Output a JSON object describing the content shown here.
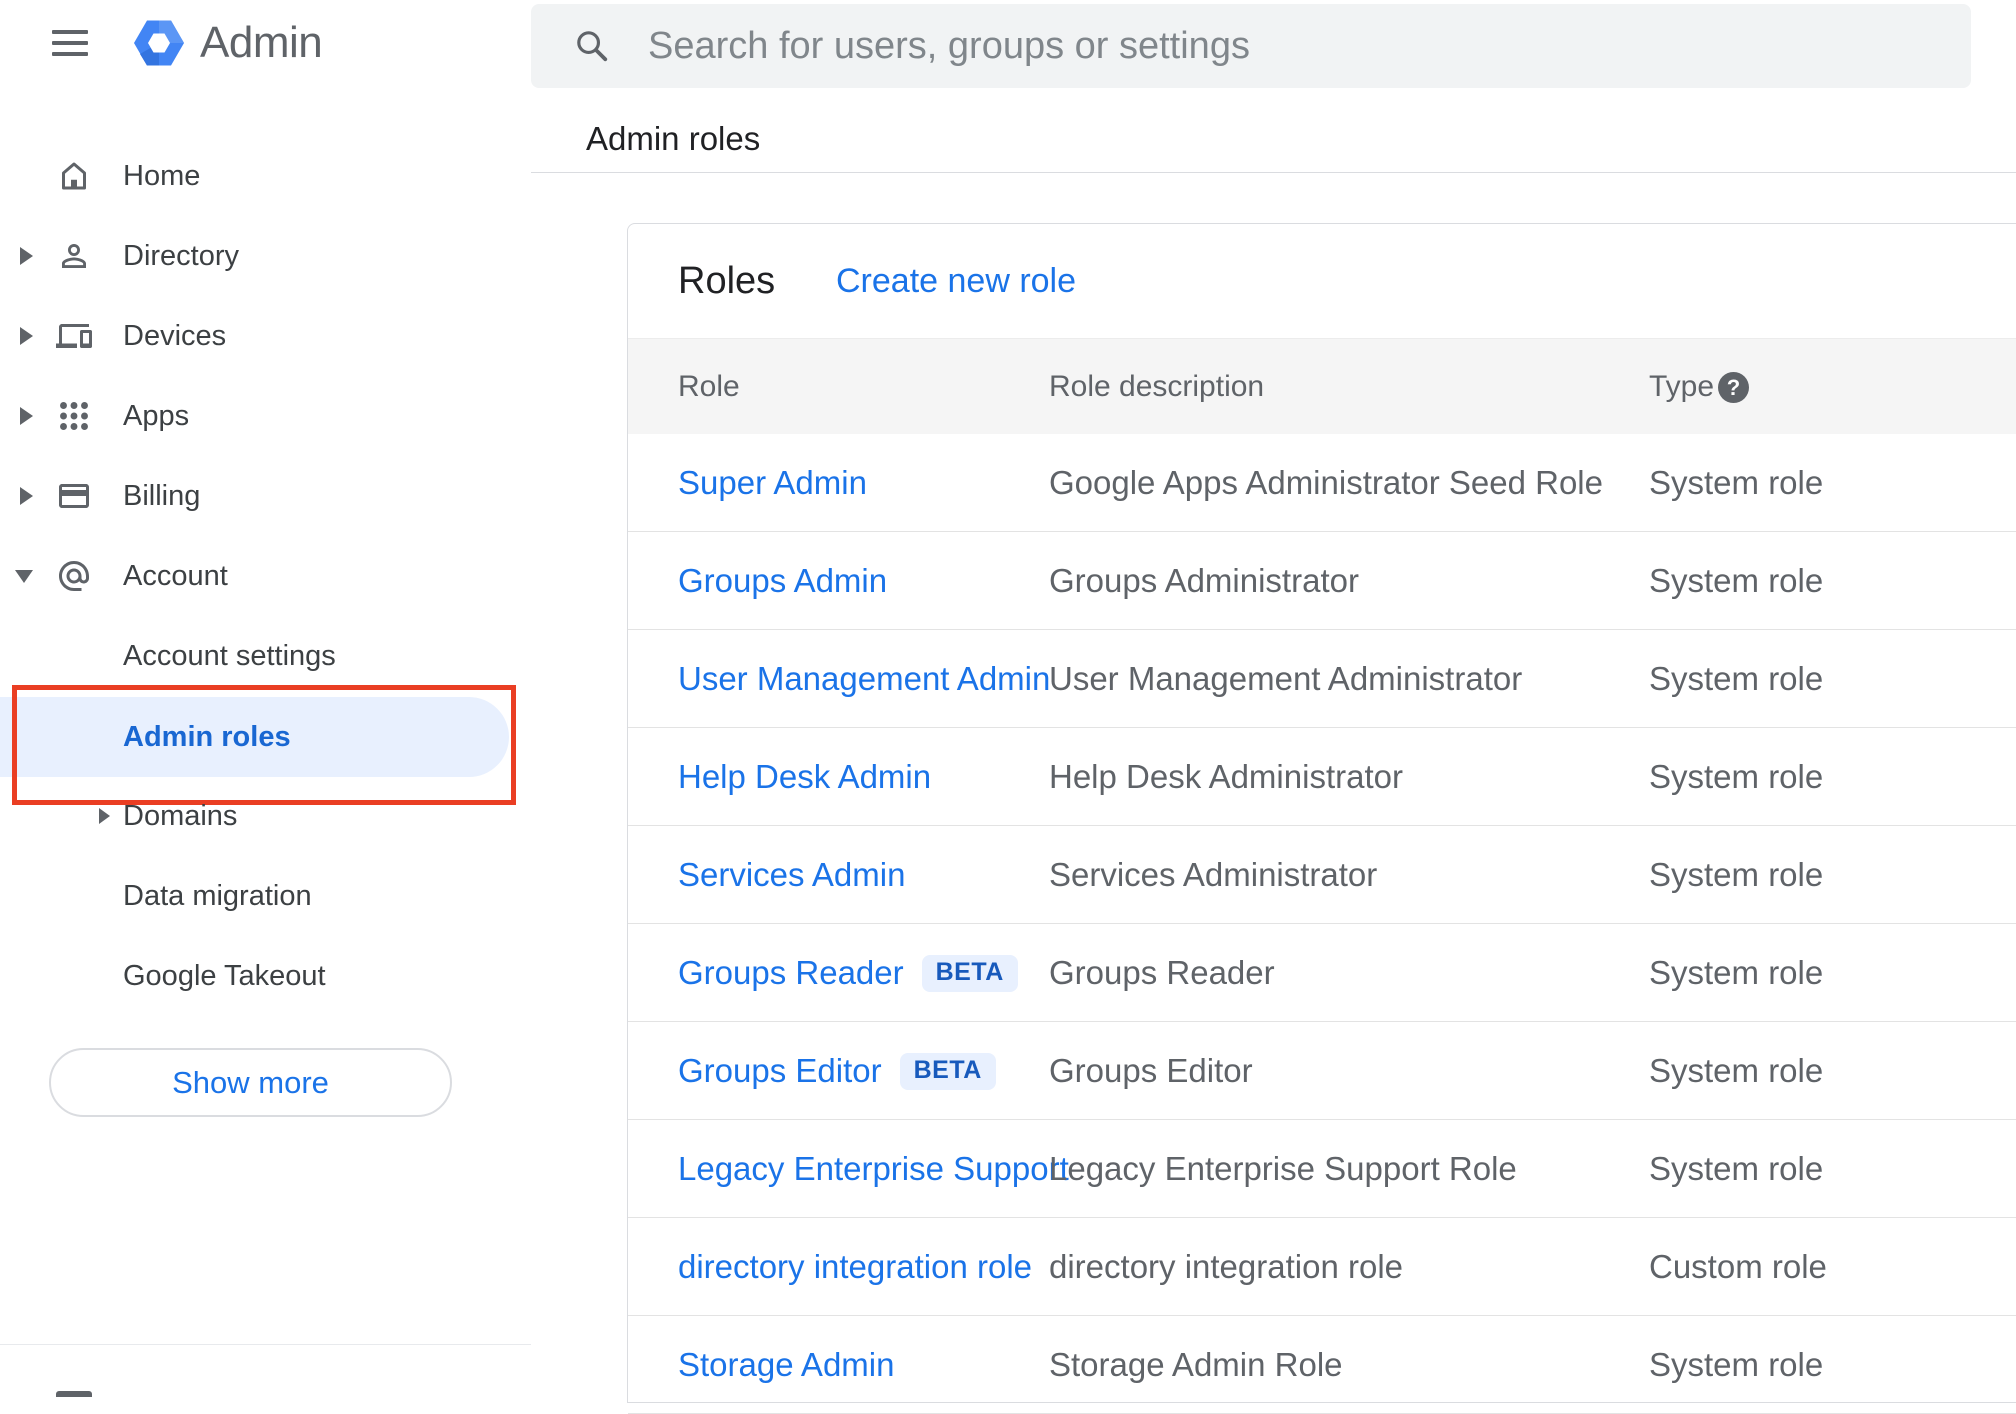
{
  "app": {
    "name": "Admin"
  },
  "search": {
    "placeholder": "Search for users, groups or settings"
  },
  "breadcrumb": "Admin roles",
  "sidebar": {
    "items": [
      {
        "label": "Home"
      },
      {
        "label": "Directory"
      },
      {
        "label": "Devices"
      },
      {
        "label": "Apps"
      },
      {
        "label": "Billing"
      },
      {
        "label": "Account"
      }
    ],
    "account_children": [
      {
        "label": "Account settings"
      },
      {
        "label": "Admin roles",
        "selected": true
      },
      {
        "label": "Domains"
      },
      {
        "label": "Data migration"
      },
      {
        "label": "Google Takeout"
      }
    ],
    "show_more_label": "Show more"
  },
  "roles_panel": {
    "title": "Roles",
    "create_link": "Create new role",
    "columns": {
      "role": "Role",
      "description": "Role description",
      "type": "Type"
    },
    "help_glyph": "?",
    "beta_label": "BETA",
    "rows": [
      {
        "role": "Super Admin",
        "description": "Google Apps Administrator Seed Role",
        "type": "System role"
      },
      {
        "role": "Groups Admin",
        "description": "Groups Administrator",
        "type": "System role"
      },
      {
        "role": "User Management Admin",
        "description": "User Management Administrator",
        "type": "System role"
      },
      {
        "role": "Help Desk Admin",
        "description": "Help Desk Administrator",
        "type": "System role"
      },
      {
        "role": "Services Admin",
        "description": "Services Administrator",
        "type": "System role"
      },
      {
        "role": "Groups Reader",
        "beta": true,
        "description": "Groups Reader",
        "type": "System role"
      },
      {
        "role": "Groups Editor",
        "beta": true,
        "description": "Groups Editor",
        "type": "System role"
      },
      {
        "role": "Legacy Enterprise Support",
        "description": "Legacy Enterprise Support Role",
        "type": "System role"
      },
      {
        "role": "directory integration role",
        "description": "directory integration role",
        "type": "Custom role"
      },
      {
        "role": "Storage Admin",
        "description": "Storage Admin Role",
        "type": "System role"
      }
    ]
  },
  "colors": {
    "accent_blue": "#1a73e8",
    "selected_text": "#1967d2",
    "selected_bg": "#e8f0fe",
    "annotation_red": "#ea3e23",
    "beta_bg": "#e8f0fe",
    "beta_text": "#185abc",
    "header_band_bg": "#f5f5f5",
    "text_dark": "#202124",
    "text_gray": "#5f6368"
  }
}
